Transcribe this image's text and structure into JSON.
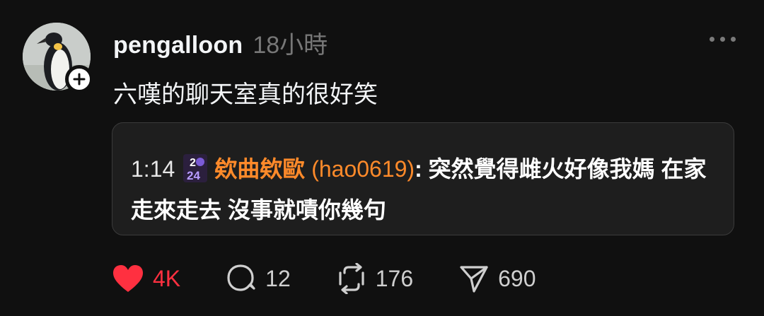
{
  "post": {
    "username": "pengalloon",
    "timestamp": "18小時",
    "text": "六嘆的聊天室真的很好笑"
  },
  "quote": {
    "time": "1:14",
    "badge_top": "2",
    "badge_bottom": "24",
    "author_name": "欸曲欸歐",
    "author_id": "(hao0619)",
    "separator": ":",
    "message": "突然覺得雌火好像我媽 在家走來走去 沒事就嘖你幾句"
  },
  "actions": {
    "likes": "4K",
    "comments": "12",
    "reposts": "176",
    "shares": "690"
  },
  "colors": {
    "like_red": "#ff3040",
    "chat_name_orange": "#ff8a2a",
    "background": "#101010"
  }
}
